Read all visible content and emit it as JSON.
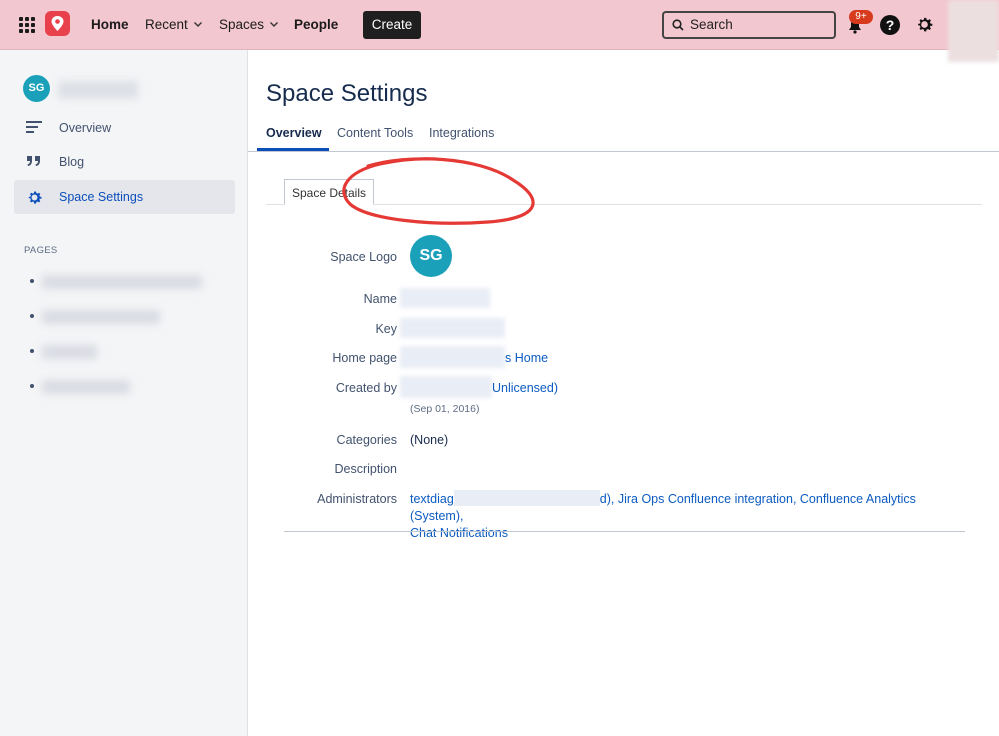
{
  "topbar": {
    "nav": {
      "home": "Home",
      "recent": "Recent",
      "spaces": "Spaces",
      "people": "People"
    },
    "create_label": "Create",
    "search_placeholder": "Search",
    "notifications_badge": "9+",
    "help_label": "?"
  },
  "sidebar": {
    "space_avatar": "SG",
    "items": [
      {
        "label": "Overview",
        "icon": "menu-lines-icon"
      },
      {
        "label": "Blog",
        "icon": "quote-icon"
      },
      {
        "label": "Space Settings",
        "icon": "gear-icon",
        "active": true
      }
    ],
    "pages_heading": "PAGES"
  },
  "main": {
    "title": "Space Settings",
    "tabs": [
      "Overview",
      "Content Tools",
      "Integrations"
    ],
    "active_tab": "Overview",
    "subtab": "Space Details",
    "details": {
      "logo_label": "Space Logo",
      "logo_text": "SG",
      "name_label": "Name",
      "key_label": "Key",
      "home_label": "Home page",
      "home_value": "s Home",
      "created_label": "Created by",
      "created_value": "Unlicensed)",
      "created_date": "(Sep 01, 2016)",
      "categories_label": "Categories",
      "categories_value": "(None)",
      "description_label": "Description",
      "admins_label": "Administrators",
      "admins_prefix": "textdiag",
      "admins_rest": "d), Jira Ops Confluence integration, Confluence Analytics (System),",
      "admins_line2": "Chat Notifications"
    }
  },
  "colors": {
    "topbar_bg": "#f3c7cf",
    "accent": "#0c4fbb",
    "avatar": "#1ba0b9",
    "annotation": "#e53935"
  }
}
